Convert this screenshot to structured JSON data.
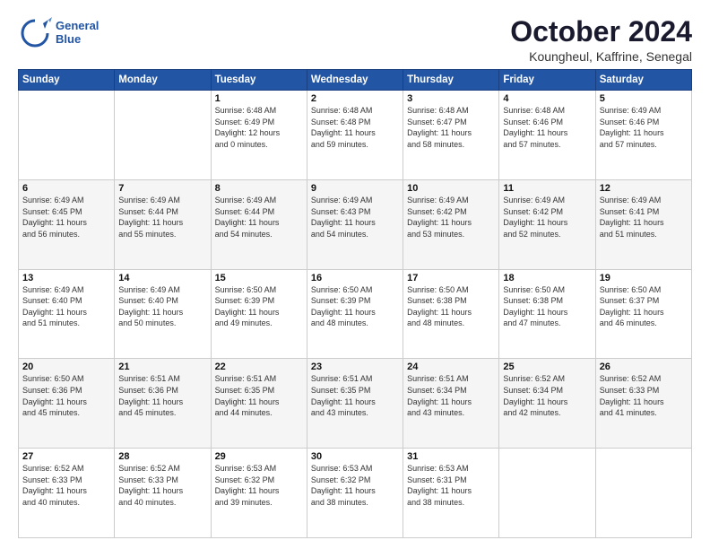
{
  "logo": {
    "line1": "General",
    "line2": "Blue"
  },
  "title": "October 2024",
  "subtitle": "Koungheul, Kaffrine, Senegal",
  "headers": [
    "Sunday",
    "Monday",
    "Tuesday",
    "Wednesday",
    "Thursday",
    "Friday",
    "Saturday"
  ],
  "weeks": [
    [
      {
        "day": "",
        "info": ""
      },
      {
        "day": "",
        "info": ""
      },
      {
        "day": "1",
        "info": "Sunrise: 6:48 AM\nSunset: 6:49 PM\nDaylight: 12 hours\nand 0 minutes."
      },
      {
        "day": "2",
        "info": "Sunrise: 6:48 AM\nSunset: 6:48 PM\nDaylight: 11 hours\nand 59 minutes."
      },
      {
        "day": "3",
        "info": "Sunrise: 6:48 AM\nSunset: 6:47 PM\nDaylight: 11 hours\nand 58 minutes."
      },
      {
        "day": "4",
        "info": "Sunrise: 6:48 AM\nSunset: 6:46 PM\nDaylight: 11 hours\nand 57 minutes."
      },
      {
        "day": "5",
        "info": "Sunrise: 6:49 AM\nSunset: 6:46 PM\nDaylight: 11 hours\nand 57 minutes."
      }
    ],
    [
      {
        "day": "6",
        "info": "Sunrise: 6:49 AM\nSunset: 6:45 PM\nDaylight: 11 hours\nand 56 minutes."
      },
      {
        "day": "7",
        "info": "Sunrise: 6:49 AM\nSunset: 6:44 PM\nDaylight: 11 hours\nand 55 minutes."
      },
      {
        "day": "8",
        "info": "Sunrise: 6:49 AM\nSunset: 6:44 PM\nDaylight: 11 hours\nand 54 minutes."
      },
      {
        "day": "9",
        "info": "Sunrise: 6:49 AM\nSunset: 6:43 PM\nDaylight: 11 hours\nand 54 minutes."
      },
      {
        "day": "10",
        "info": "Sunrise: 6:49 AM\nSunset: 6:42 PM\nDaylight: 11 hours\nand 53 minutes."
      },
      {
        "day": "11",
        "info": "Sunrise: 6:49 AM\nSunset: 6:42 PM\nDaylight: 11 hours\nand 52 minutes."
      },
      {
        "day": "12",
        "info": "Sunrise: 6:49 AM\nSunset: 6:41 PM\nDaylight: 11 hours\nand 51 minutes."
      }
    ],
    [
      {
        "day": "13",
        "info": "Sunrise: 6:49 AM\nSunset: 6:40 PM\nDaylight: 11 hours\nand 51 minutes."
      },
      {
        "day": "14",
        "info": "Sunrise: 6:49 AM\nSunset: 6:40 PM\nDaylight: 11 hours\nand 50 minutes."
      },
      {
        "day": "15",
        "info": "Sunrise: 6:50 AM\nSunset: 6:39 PM\nDaylight: 11 hours\nand 49 minutes."
      },
      {
        "day": "16",
        "info": "Sunrise: 6:50 AM\nSunset: 6:39 PM\nDaylight: 11 hours\nand 48 minutes."
      },
      {
        "day": "17",
        "info": "Sunrise: 6:50 AM\nSunset: 6:38 PM\nDaylight: 11 hours\nand 48 minutes."
      },
      {
        "day": "18",
        "info": "Sunrise: 6:50 AM\nSunset: 6:38 PM\nDaylight: 11 hours\nand 47 minutes."
      },
      {
        "day": "19",
        "info": "Sunrise: 6:50 AM\nSunset: 6:37 PM\nDaylight: 11 hours\nand 46 minutes."
      }
    ],
    [
      {
        "day": "20",
        "info": "Sunrise: 6:50 AM\nSunset: 6:36 PM\nDaylight: 11 hours\nand 45 minutes."
      },
      {
        "day": "21",
        "info": "Sunrise: 6:51 AM\nSunset: 6:36 PM\nDaylight: 11 hours\nand 45 minutes."
      },
      {
        "day": "22",
        "info": "Sunrise: 6:51 AM\nSunset: 6:35 PM\nDaylight: 11 hours\nand 44 minutes."
      },
      {
        "day": "23",
        "info": "Sunrise: 6:51 AM\nSunset: 6:35 PM\nDaylight: 11 hours\nand 43 minutes."
      },
      {
        "day": "24",
        "info": "Sunrise: 6:51 AM\nSunset: 6:34 PM\nDaylight: 11 hours\nand 43 minutes."
      },
      {
        "day": "25",
        "info": "Sunrise: 6:52 AM\nSunset: 6:34 PM\nDaylight: 11 hours\nand 42 minutes."
      },
      {
        "day": "26",
        "info": "Sunrise: 6:52 AM\nSunset: 6:33 PM\nDaylight: 11 hours\nand 41 minutes."
      }
    ],
    [
      {
        "day": "27",
        "info": "Sunrise: 6:52 AM\nSunset: 6:33 PM\nDaylight: 11 hours\nand 40 minutes."
      },
      {
        "day": "28",
        "info": "Sunrise: 6:52 AM\nSunset: 6:33 PM\nDaylight: 11 hours\nand 40 minutes."
      },
      {
        "day": "29",
        "info": "Sunrise: 6:53 AM\nSunset: 6:32 PM\nDaylight: 11 hours\nand 39 minutes."
      },
      {
        "day": "30",
        "info": "Sunrise: 6:53 AM\nSunset: 6:32 PM\nDaylight: 11 hours\nand 38 minutes."
      },
      {
        "day": "31",
        "info": "Sunrise: 6:53 AM\nSunset: 6:31 PM\nDaylight: 11 hours\nand 38 minutes."
      },
      {
        "day": "",
        "info": ""
      },
      {
        "day": "",
        "info": ""
      }
    ]
  ]
}
